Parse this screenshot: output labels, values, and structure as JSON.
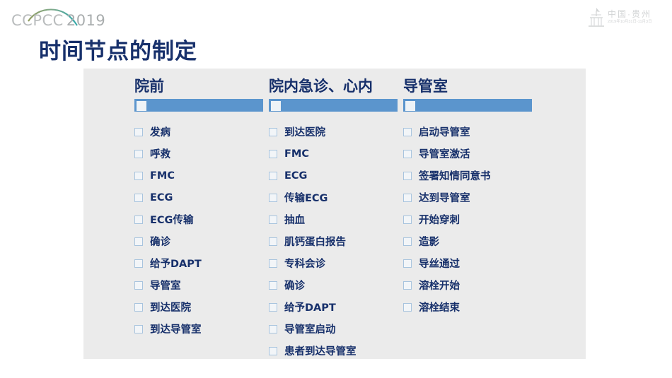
{
  "brand": {
    "logo_text": "CCPCC",
    "logo_year": "2019",
    "arc_color_left": "#8f9c5e",
    "arc_color_right": "#3aa9a8"
  },
  "venue": {
    "name": "中国·贵州",
    "date_range": "2019年10月31日-11月3日"
  },
  "title": "时间节点的制定",
  "theme": {
    "panel_background": "#ebebeb",
    "accent_blue": "#5b95cd",
    "text_navy": "#17306b",
    "checkbox_border": "#a8c4de"
  },
  "columns": [
    {
      "header": "院前",
      "items": [
        "发病",
        "呼救",
        "FMC",
        "ECG",
        "ECG传输",
        "确诊",
        "给予DAPT",
        "导管室",
        "到达医院",
        "到达导管室"
      ]
    },
    {
      "header": "院内急诊、心内",
      "items": [
        "到达医院",
        "FMC",
        "ECG",
        "传输ECG",
        "抽血",
        "肌钙蛋白报告",
        "专科会诊",
        "确诊",
        "给予DAPT",
        "导管室启动",
        "患者到达导管室"
      ]
    },
    {
      "header": "导管室",
      "items": [
        "启动导管室",
        "导管室激活",
        "签署知情同意书",
        "达到导管室",
        "开始穿刺",
        "造影",
        "导丝通过",
        "溶栓开始",
        "溶栓结束"
      ]
    }
  ]
}
